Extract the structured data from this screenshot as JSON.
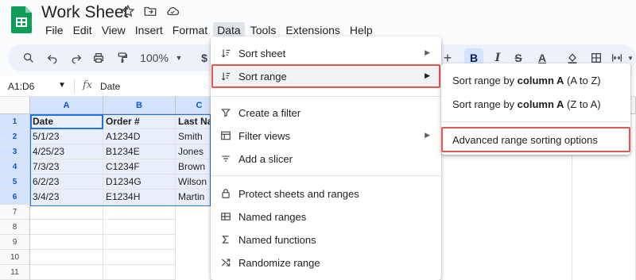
{
  "doc_title": "Work Sheet",
  "menubar": [
    "File",
    "Edit",
    "View",
    "Insert",
    "Format",
    "Data",
    "Tools",
    "Extensions",
    "Help"
  ],
  "toolbar": {
    "zoom": "100%",
    "currency": "$"
  },
  "formula_bar": {
    "name_box": "A1:D6",
    "fx": "fx",
    "value": "Date"
  },
  "columns": [
    "A",
    "B",
    "C"
  ],
  "column_c_partial": "Last Na",
  "rows": [
    [
      "Date",
      "Order #",
      ""
    ],
    [
      "5/1/23",
      "A1234D",
      "Smith"
    ],
    [
      "4/25/23",
      "B1234E",
      "Jones"
    ],
    [
      "7/3/23",
      "C1234F",
      "Brown"
    ],
    [
      "6/2/23",
      "D1234G",
      "Wilson"
    ],
    [
      "3/4/23",
      "E1234H",
      "Martin"
    ]
  ],
  "row_numbers": [
    "1",
    "2",
    "3",
    "4",
    "5",
    "6",
    "7",
    "8",
    "9",
    "10",
    "11"
  ],
  "data_menu": {
    "items": [
      {
        "label": "Sort sheet",
        "icon": "sort-icon",
        "submenu": true
      },
      {
        "label": "Sort range",
        "icon": "sort-icon",
        "submenu": true,
        "highlighted": true
      },
      {
        "label": "Create a filter",
        "icon": "filter-icon",
        "submenu": false
      },
      {
        "label": "Filter views",
        "icon": "filter-views-icon",
        "submenu": true
      },
      {
        "label": "Add a slicer",
        "icon": "slicer-icon",
        "submenu": false
      },
      {
        "label": "Protect sheets and ranges",
        "icon": "lock-icon",
        "submenu": false
      },
      {
        "label": "Named ranges",
        "icon": "named-ranges-icon",
        "submenu": false
      },
      {
        "label": "Named functions",
        "icon": "sigma-icon",
        "submenu": false
      },
      {
        "label": "Randomize range",
        "icon": "shuffle-icon",
        "submenu": false
      }
    ]
  },
  "sort_submenu": {
    "az_prefix": "Sort range by ",
    "az_bold": "column A",
    "az_suffix": " (A to Z)",
    "za_prefix": "Sort range by ",
    "za_bold": "column A",
    "za_suffix": " (Z to A)",
    "advanced": "Advanced range sorting options"
  },
  "colors": {
    "accent": "#1a73e8",
    "highlight_box": "#e8574f",
    "sheets_green": "#0f9d58"
  }
}
